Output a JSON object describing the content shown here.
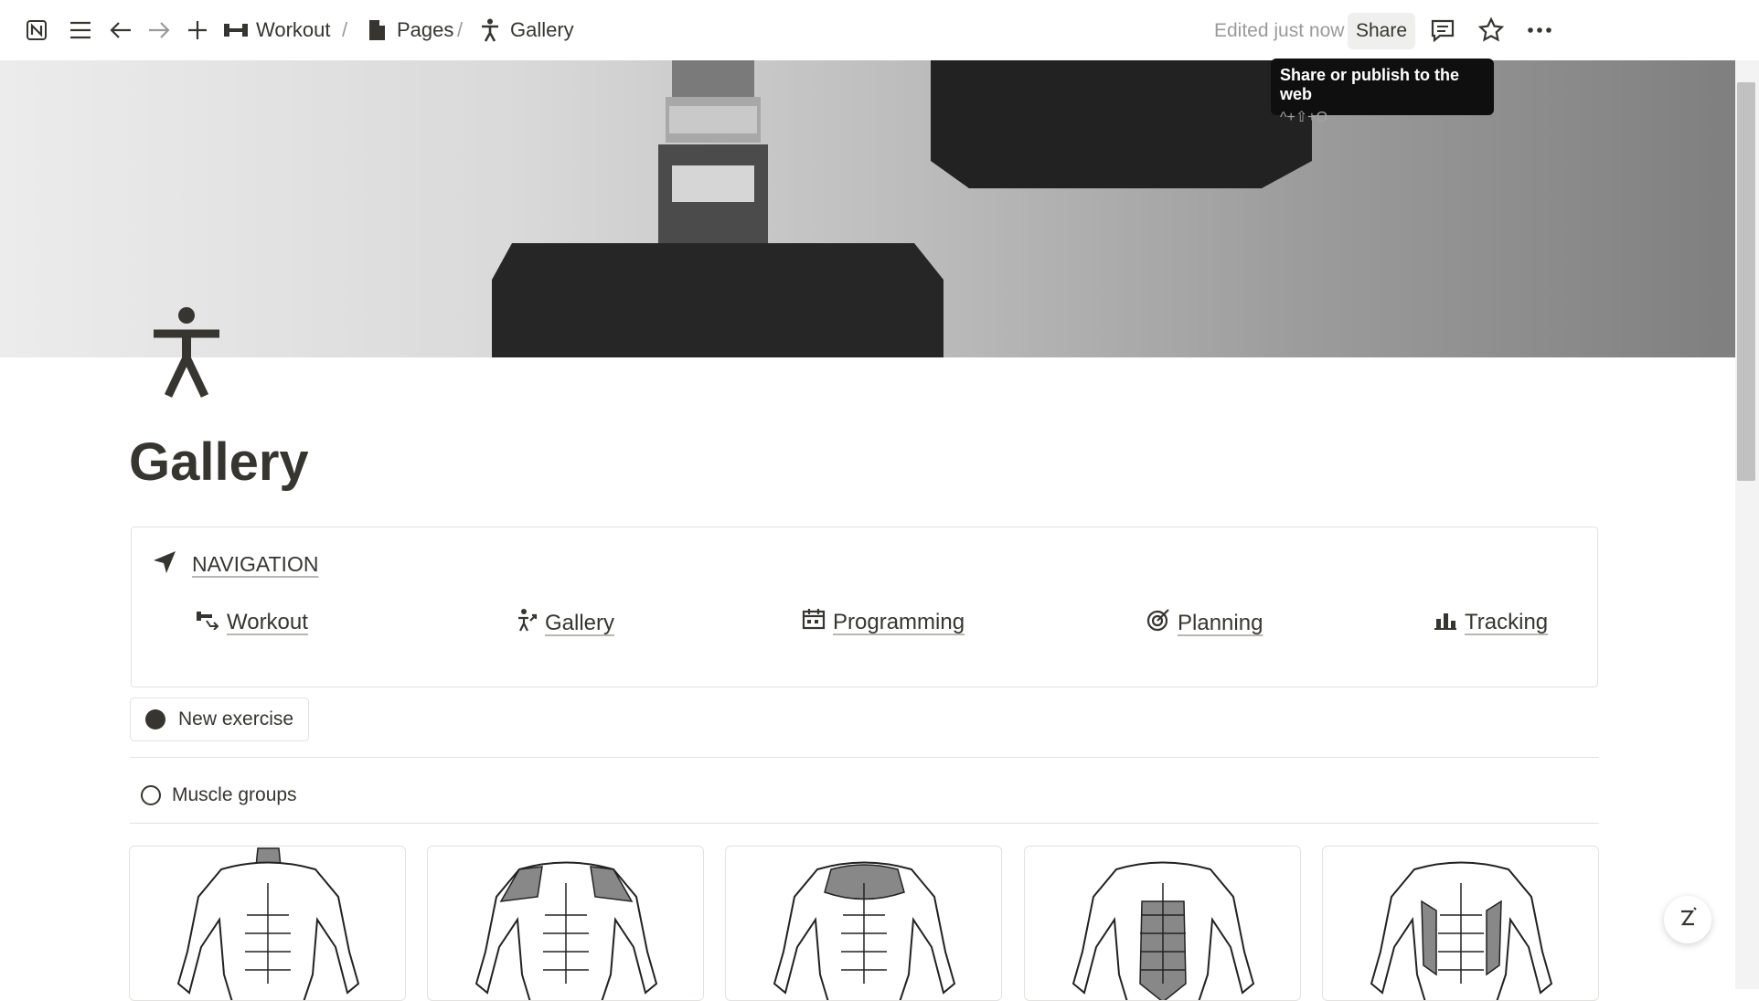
{
  "topbar": {
    "breadcrumbs": [
      {
        "label": "Workout",
        "icon": "dumbbell-icon"
      },
      {
        "label": "Pages",
        "icon": "document-icon"
      },
      {
        "label": "Gallery",
        "icon": "person-icon"
      }
    ],
    "separator": "/",
    "edited": "Edited just now",
    "share_label": "Share"
  },
  "tooltip": {
    "title": "Share or publish to the web",
    "shortcut": "^+⇧+O"
  },
  "page": {
    "title": "Gallery",
    "icon": "person-icon"
  },
  "navigation": {
    "heading": "NAVIGATION",
    "links": [
      {
        "label": "Workout",
        "icon": "workout-icon"
      },
      {
        "label": "Gallery",
        "icon": "gallery-icon"
      },
      {
        "label": "Programming",
        "icon": "calendar-icon"
      },
      {
        "label": "Planning",
        "icon": "target-icon"
      },
      {
        "label": "Tracking",
        "icon": "chart-icon"
      }
    ]
  },
  "new_button": {
    "label": "New exercise"
  },
  "muscle_groups": {
    "label": "Muscle groups"
  },
  "colors": {
    "text": "#37352f",
    "muted": "#9b9a97",
    "border": "#e3e2e0",
    "highlight": "#888888"
  }
}
